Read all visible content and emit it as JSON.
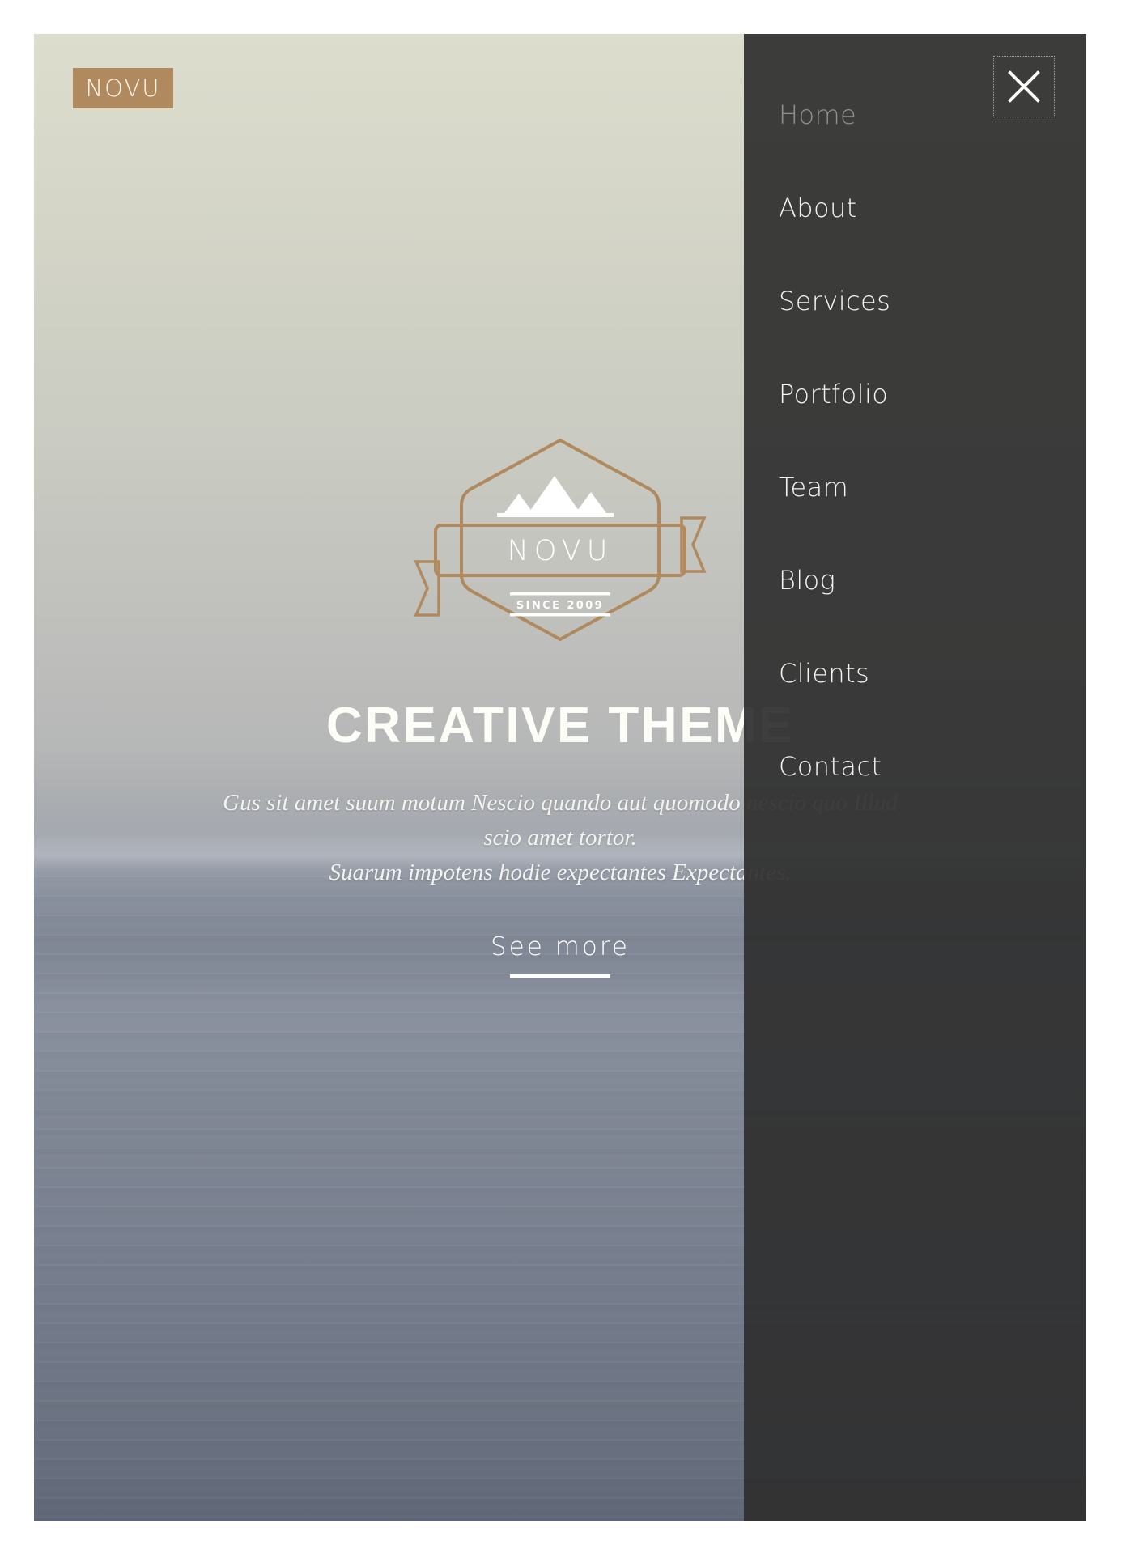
{
  "brand": {
    "logo_text": "NOVU",
    "logo_bg_color": "#b08a5e",
    "logo_text_color": "#fdf7ee"
  },
  "hero": {
    "badge": {
      "name": "NOVU",
      "since_text": "SINCE 2009",
      "outline_color": "#b08a5e",
      "icon": "mountain-icon"
    },
    "title": "CREATIVE THEME",
    "subtitle_lines": [
      "Gus sit amet suum motum Nescio quando aut quomodo nescio quo Illud",
      "scio amet tortor.",
      "Suarum impotens hodie expectantes Expectantes."
    ],
    "cta_label": "See more"
  },
  "nav": {
    "close_label": "close-icon",
    "active_index": 0,
    "items": [
      {
        "label": "Home"
      },
      {
        "label": "About"
      },
      {
        "label": "Services"
      },
      {
        "label": "Portfolio"
      },
      {
        "label": "Team"
      },
      {
        "label": "Blog"
      },
      {
        "label": "Clients"
      },
      {
        "label": "Contact"
      }
    ]
  },
  "theme": {
    "panel_bg": "#2f2f2f",
    "accent": "#b08a5e",
    "text_light": "#f4f4f2",
    "text_muted": "#909090"
  }
}
